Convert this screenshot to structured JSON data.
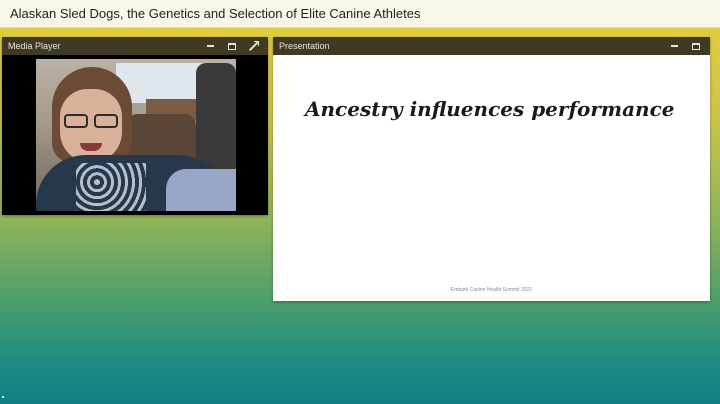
{
  "app": {
    "title": "Alaskan Sled Dogs, the Genetics and Selection of Elite Canine Athletes"
  },
  "media_pod": {
    "title": "Media Player",
    "icons": [
      "minimize-icon",
      "maximize-icon",
      "expand-icon"
    ]
  },
  "presentation_pod": {
    "title": "Presentation",
    "icons": [
      "minimize-icon",
      "maximize-icon"
    ],
    "slide": {
      "title": "Ancestry influences performance",
      "footer": "Embark Canine Health Summit 2022"
    }
  },
  "colors": {
    "pod_header": "#3f3a21",
    "titlebar_bg": "#fbf6ea",
    "background_top": "#e9cf3f",
    "background_bottom": "#127f86"
  }
}
